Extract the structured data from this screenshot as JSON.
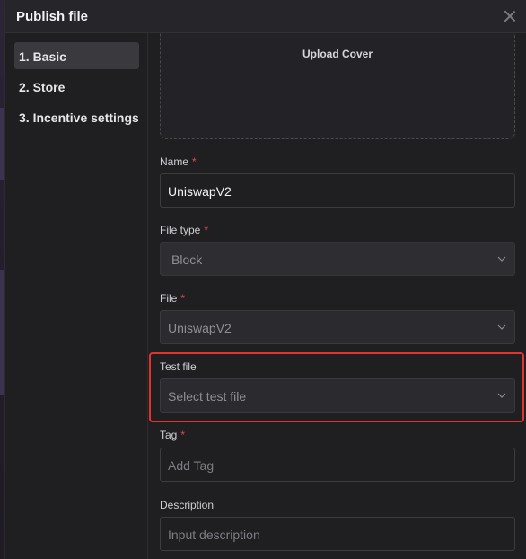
{
  "modal": {
    "title": "Publish file"
  },
  "steps": [
    {
      "label": "1. Basic",
      "active": true
    },
    {
      "label": "2. Store",
      "active": false
    },
    {
      "label": "3. Incentive settings",
      "active": false
    }
  ],
  "upload": {
    "label": "Upload Cover"
  },
  "fields": {
    "name": {
      "label": "Name",
      "required": "*",
      "value": "UniswapV2"
    },
    "file_type": {
      "label": "File type",
      "required": "*",
      "value": "Block"
    },
    "file": {
      "label": "File",
      "required": "*",
      "value": "UniswapV2"
    },
    "test_file": {
      "label": "Test file",
      "placeholder": "Select test file"
    },
    "tag": {
      "label": "Tag",
      "required": "*",
      "placeholder": "Add Tag"
    },
    "description": {
      "label": "Description",
      "placeholder": "Input description"
    }
  },
  "colors": {
    "required": "#e5484d",
    "highlight": "#e2332e",
    "active_step": "#3a3a3e"
  }
}
